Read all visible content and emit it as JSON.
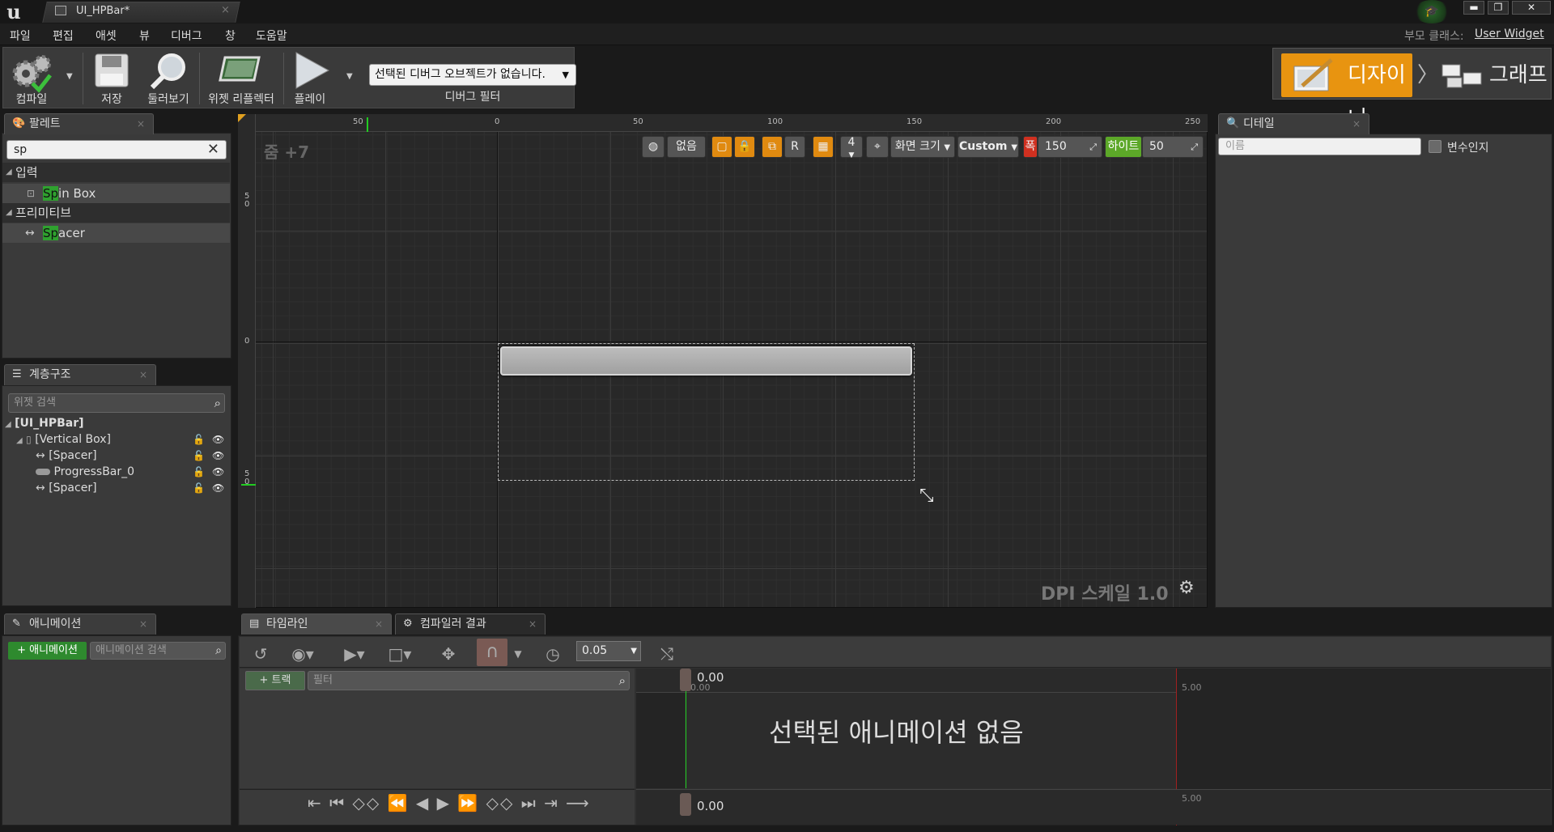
{
  "window": {
    "tab_title": "UI_HPBar*",
    "close_glyph": "×",
    "controls": [
      "▬",
      "❐",
      "✕"
    ]
  },
  "menu": [
    "파일",
    "편집",
    "애셋",
    "뷰",
    "디버그",
    "창",
    "도움말"
  ],
  "parent_class": {
    "label": "부모 클래스:",
    "value": "User Widget"
  },
  "toolbar": {
    "compile": "컴파일",
    "save": "저장",
    "browse": "둘러보기",
    "reflector": "위젯 리플렉터",
    "play": "플레이",
    "debug_object": "선택된 디버그 오브젝트가 없습니다.",
    "debug_filter": "디버그 필터"
  },
  "mode": {
    "designer": "디자이너",
    "graph": "그래프"
  },
  "palette": {
    "tab": "팔레트",
    "search_value": "sp",
    "categories": [
      {
        "name": "입력",
        "items": [
          {
            "highlight": "Sp",
            "rest": "in Box"
          }
        ]
      },
      {
        "name": "프리미티브",
        "items": [
          {
            "highlight": "Sp",
            "rest": "acer"
          }
        ]
      }
    ]
  },
  "hierarchy": {
    "tab": "계층구조",
    "search_placeholder": "위젯 검색",
    "root": "[UI_HPBar]",
    "nodes": [
      "[Vertical Box]",
      "[Spacer]",
      "ProgressBar_0",
      "[Spacer]"
    ]
  },
  "designer": {
    "zoom": "줌 +7",
    "dpi": "DPI 스케일 1.0",
    "ruler_x": [
      "50",
      "0",
      "50",
      "100",
      "150",
      "200",
      "250"
    ],
    "ruler_y": [
      "5\n0",
      "0",
      "5\n0"
    ],
    "localization": "없음",
    "r_label": "R",
    "grid_snap": "4",
    "screen_size": "화면 크기",
    "custom": "Custom",
    "width_label": "폭",
    "width_value": "150",
    "height_label": "하이트",
    "height_value": "50"
  },
  "details": {
    "tab": "디테일",
    "name_placeholder": "이름",
    "is_variable": "변수인지"
  },
  "animations": {
    "tab": "애니메이션",
    "add_button": "+ 애니메이션",
    "search_placeholder": "애니메이션 검색"
  },
  "timeline": {
    "tab_timeline": "타임라인",
    "tab_compiler": "컴파일러 결과",
    "snap_value": "0.05",
    "track_button": "+ 트랙",
    "filter_placeholder": "필터",
    "no_animation": "선택된 애니메이션 없음",
    "time_start": "0.00",
    "time_end": "5.00"
  }
}
